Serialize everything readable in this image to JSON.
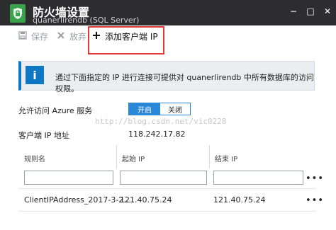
{
  "header": {
    "title": "防火墙设置",
    "subtitle": "quanerlirendb (SQL Server)",
    "controls": [
      "−",
      "□",
      "✕"
    ]
  },
  "toolbar": {
    "save_label": "保存",
    "discard_label": "放弃",
    "add_label": "添加客户端 IP"
  },
  "info": {
    "text": "通过下面指定的 IP 进行连接可提供对 quanerlirendb 中所有数据库的访问权限。"
  },
  "allow_azure": {
    "label": "允许访问 Azure 服务",
    "on_label": "开启",
    "off_label": "关闭"
  },
  "client_ip": {
    "label": "客户端 IP 地址",
    "value": "118.242.17.82"
  },
  "watermark": {
    "text": "http://blog.csdn.net/vic0228"
  },
  "rules_table": {
    "headers": [
      "规则名",
      "起始 IP",
      "结束 IP"
    ],
    "new_row": {
      "name": "",
      "start": "",
      "end": ""
    },
    "rows": [
      {
        "name": "ClientIPAddress_2017-3-2...",
        "start": "121.40.75.24",
        "end": "121.40.75.24"
      }
    ]
  },
  "colors": {
    "header_bg": "#2d2d30",
    "accent_blue": "#2b88d8",
    "info_blue": "#0f78c4",
    "highlight_red": "#e53935",
    "shield_green": "#3aa24a"
  }
}
